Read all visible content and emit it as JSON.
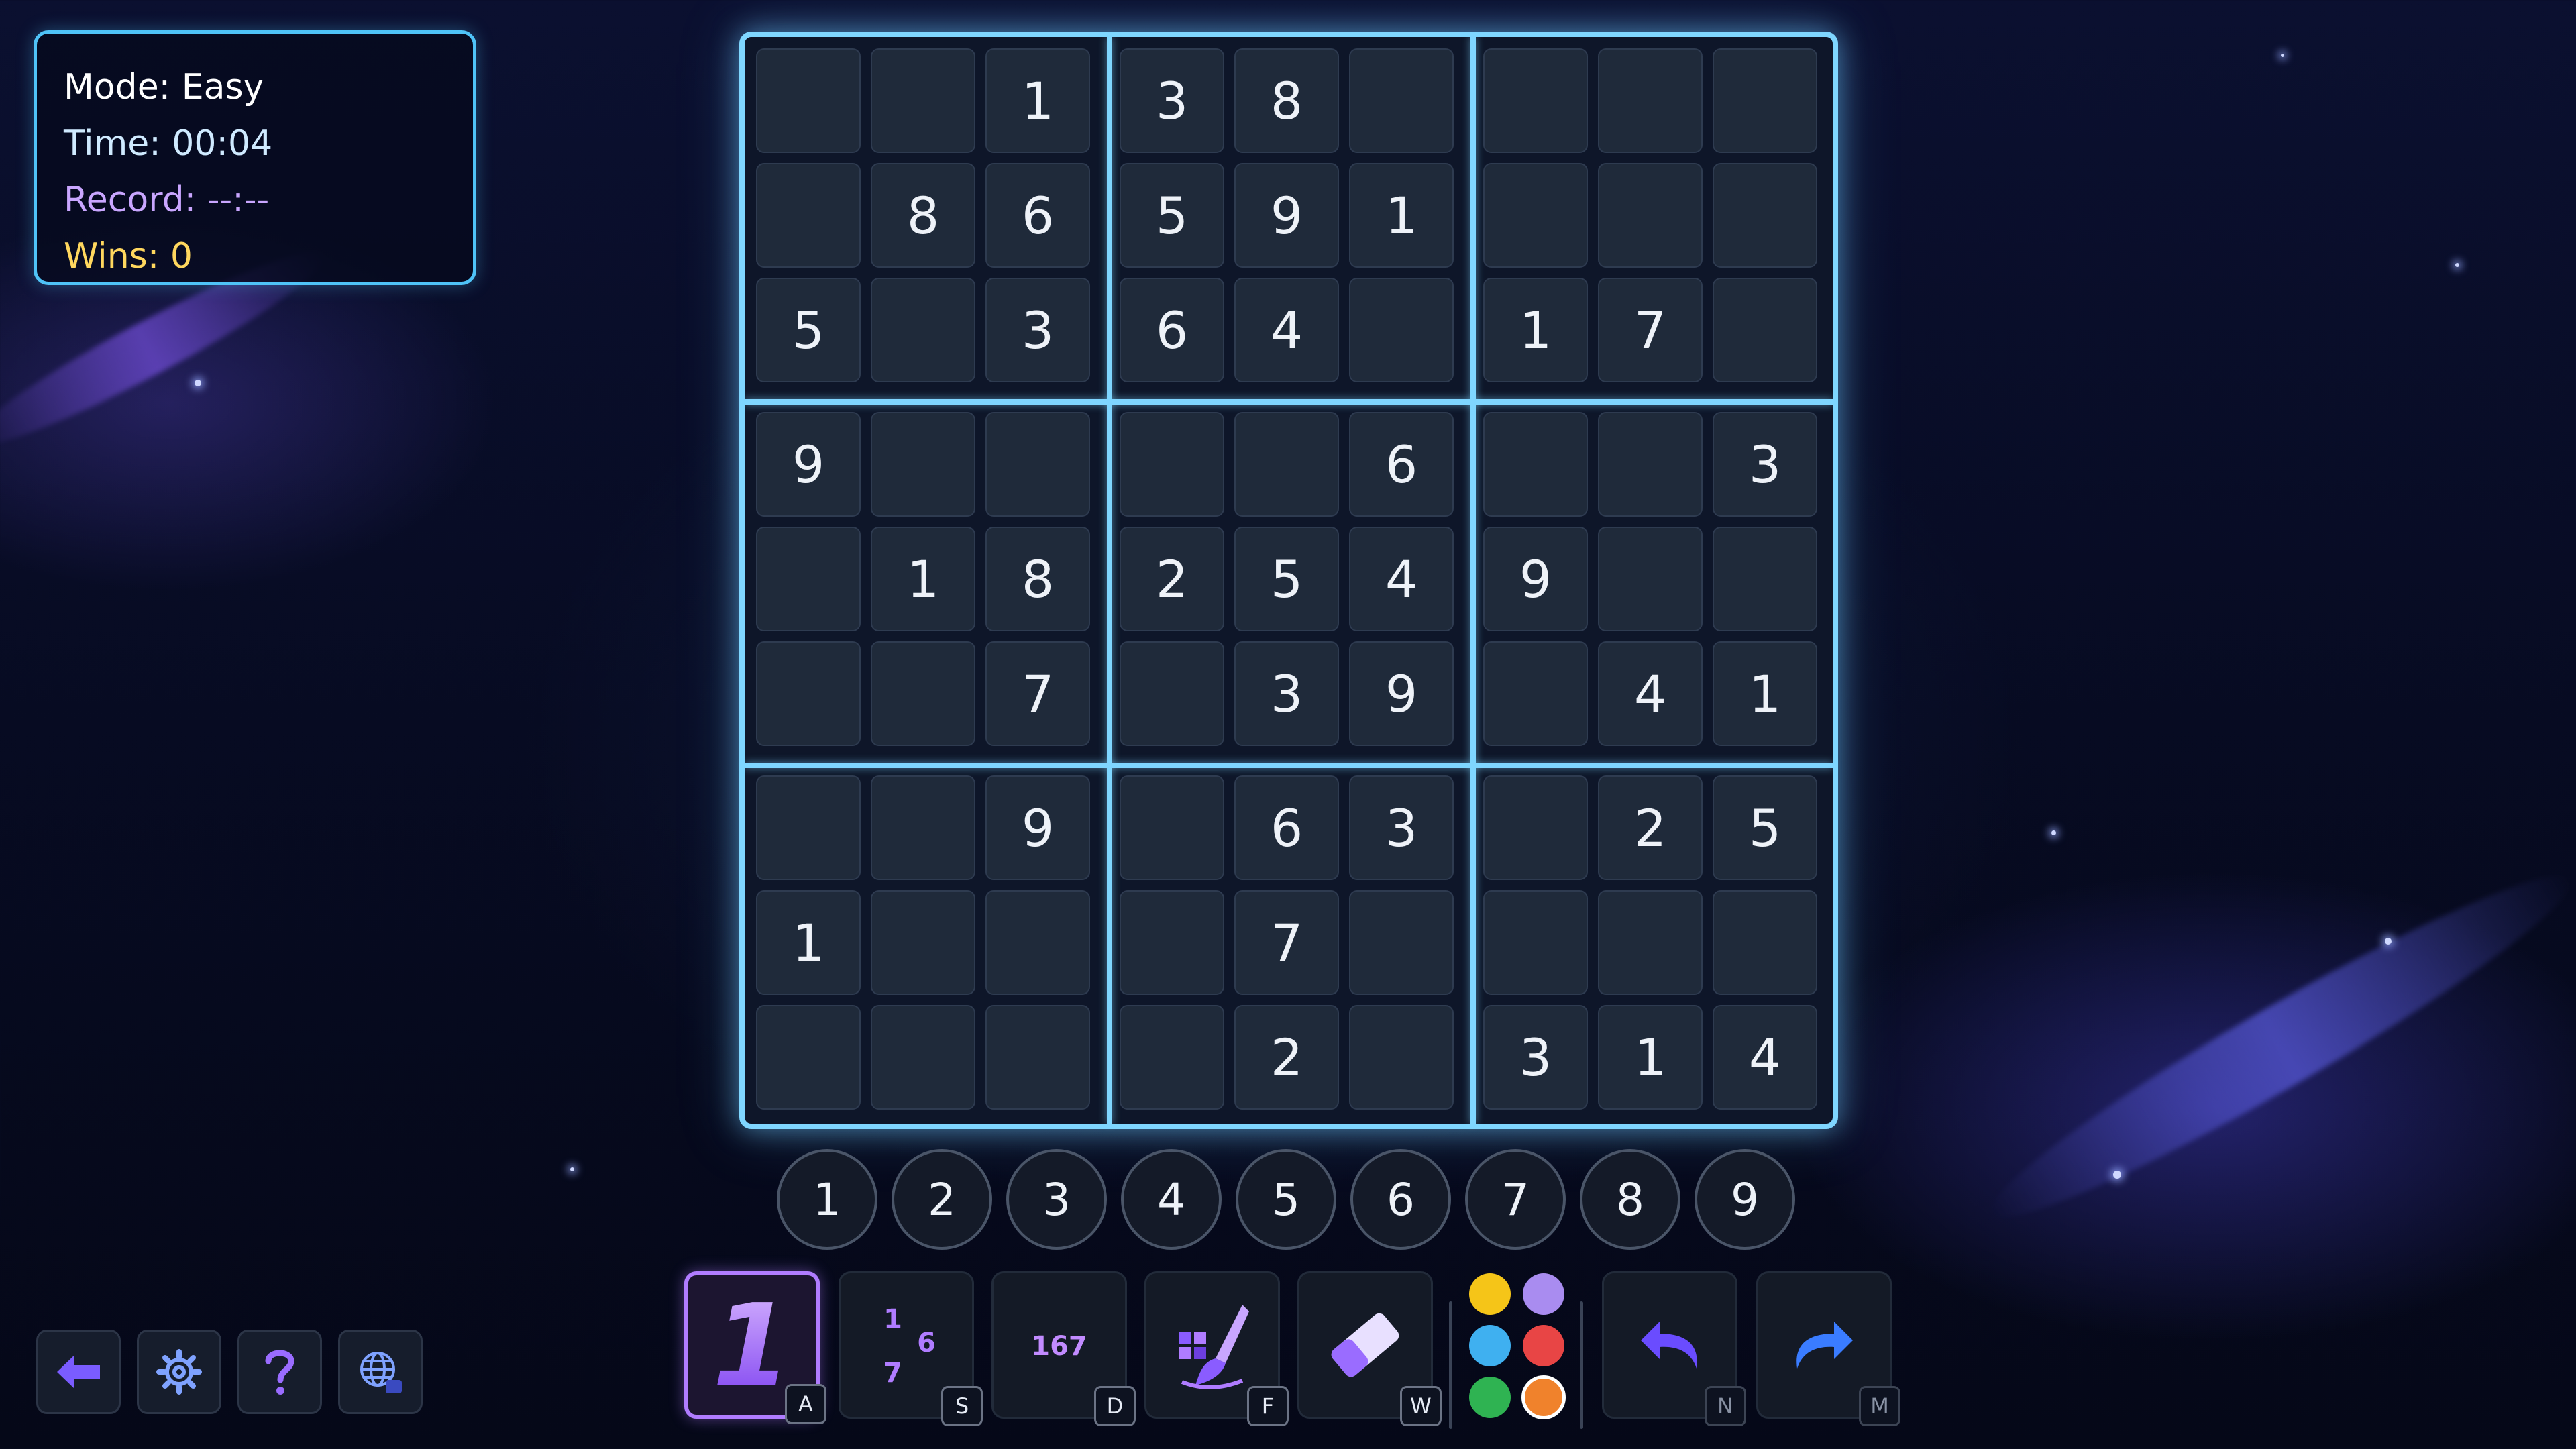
{
  "info": {
    "mode": "Mode: Easy",
    "time": "Time: 00:04",
    "record": "Record: --:--",
    "wins": "Wins: 0",
    "colors": {
      "mode": "#ffffff",
      "time": "#cfeaff",
      "record": "#c9a6ff",
      "wins": "#ffd75e"
    }
  },
  "board": {
    "grid": [
      [
        "",
        "",
        "1",
        "3",
        "8",
        "",
        "",
        "",
        ""
      ],
      [
        "",
        "8",
        "6",
        "5",
        "9",
        "1",
        "",
        "",
        ""
      ],
      [
        "5",
        "",
        "3",
        "6",
        "4",
        "",
        "1",
        "7",
        ""
      ],
      [
        "9",
        "",
        "",
        "",
        "",
        "6",
        "",
        "",
        "3"
      ],
      [
        "",
        "1",
        "8",
        "2",
        "5",
        "4",
        "9",
        "",
        ""
      ],
      [
        "",
        "",
        "7",
        "",
        "3",
        "9",
        "",
        "4",
        "1"
      ],
      [
        "",
        "",
        "9",
        "",
        "6",
        "3",
        "",
        "2",
        "5"
      ],
      [
        "1",
        "",
        "",
        "",
        "7",
        "",
        "",
        "",
        ""
      ],
      [
        "",
        "",
        "",
        "",
        "2",
        "",
        "3",
        "1",
        "4"
      ]
    ]
  },
  "number_pad": [
    "1",
    "2",
    "3",
    "4",
    "5",
    "6",
    "7",
    "8",
    "9"
  ],
  "tools": [
    {
      "name": "normal-mode",
      "hotkey": "A",
      "active": true,
      "icon": "digit-one-icon",
      "glyph": "1"
    },
    {
      "name": "candidate-mode",
      "hotkey": "S",
      "active": false,
      "icon": "candidate-notes-icon",
      "glyph_top": "1",
      "glyph_mid": "6",
      "glyph_bottom": "7"
    },
    {
      "name": "multi-candidate-mode",
      "hotkey": "D",
      "active": false,
      "icon": "multi-digit-icon",
      "glyph": "167"
    },
    {
      "name": "paint-mode",
      "hotkey": "F",
      "active": false,
      "icon": "paint-brush-icon"
    },
    {
      "name": "erase",
      "hotkey": "W",
      "active": false,
      "icon": "eraser-icon"
    }
  ],
  "palette": [
    "#f5c518",
    "#a98cf0",
    "#3fb0f0",
    "#e84545",
    "#2fb352",
    "#f0822c"
  ],
  "history": [
    {
      "name": "undo",
      "hotkey": "N",
      "icon": "undo-arrow-icon"
    },
    {
      "name": "redo",
      "hotkey": "M",
      "icon": "redo-arrow-icon"
    }
  ],
  "nav": [
    {
      "name": "back",
      "icon": "back-arrow-icon"
    },
    {
      "name": "settings",
      "icon": "gear-icon"
    },
    {
      "name": "help",
      "icon": "question-mark-icon"
    },
    {
      "name": "language",
      "icon": "globe-icon"
    }
  ]
}
